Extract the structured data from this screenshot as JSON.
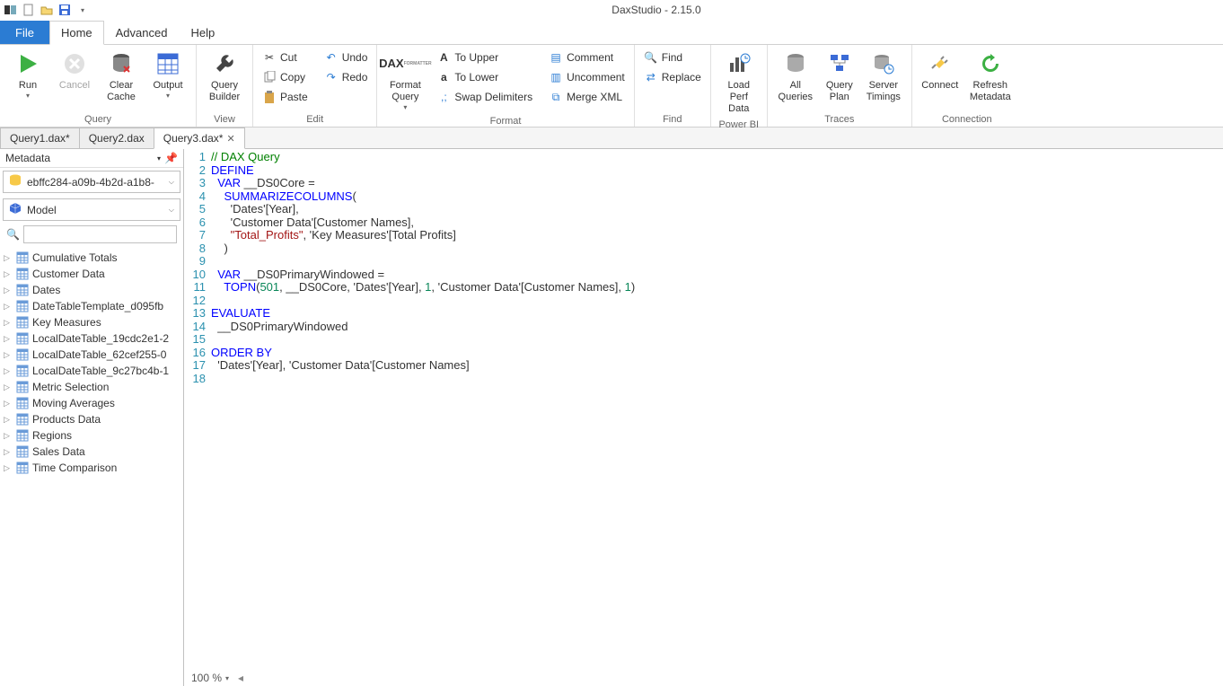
{
  "app_title": "DaxStudio - 2.15.0",
  "menu": {
    "file": "File",
    "tabs": [
      "Home",
      "Advanced",
      "Help"
    ],
    "active": "Home"
  },
  "ribbon": {
    "groups": {
      "query": {
        "label": "Query",
        "run": "Run",
        "cancel": "Cancel",
        "clear_cache": "Clear Cache",
        "output": "Output"
      },
      "view": {
        "label": "View",
        "query_builder": "Query Builder"
      },
      "edit": {
        "label": "Edit",
        "cut": "Cut",
        "copy": "Copy",
        "paste": "Paste",
        "undo": "Undo",
        "redo": "Redo"
      },
      "format": {
        "label": "Format",
        "format_query": "Format Query",
        "to_upper": "To Upper",
        "to_lower": "To Lower",
        "swap": "Swap Delimiters",
        "comment": "Comment",
        "uncomment": "Uncomment",
        "merge_xml": "Merge XML"
      },
      "find": {
        "label": "Find",
        "find": "Find",
        "replace": "Replace"
      },
      "powerbi": {
        "label": "Power BI",
        "load_perf": "Load Perf Data"
      },
      "traces": {
        "label": "Traces",
        "all_queries": "All Queries",
        "query_plan": "Query Plan",
        "server_timings": "Server Timings"
      },
      "connection": {
        "label": "Connection",
        "connect": "Connect",
        "refresh": "Refresh Metadata"
      }
    }
  },
  "doc_tabs": [
    {
      "label": "Query1.dax*",
      "active": false
    },
    {
      "label": "Query2.dax",
      "active": false
    },
    {
      "label": "Query3.dax*",
      "active": true
    }
  ],
  "metadata": {
    "title": "Metadata",
    "database": "ebffc284-a09b-4b2d-a1b8-",
    "model": "Model",
    "search": "",
    "tables": [
      "Cumulative Totals",
      "Customer Data",
      "Dates",
      "DateTableTemplate_d095fb",
      "Key Measures",
      "LocalDateTable_19cdc2e1-2",
      "LocalDateTable_62cef255-0",
      "LocalDateTable_9c27bc4b-1",
      "Metric Selection",
      "Moving Averages",
      "Products Data",
      "Regions",
      "Sales Data",
      "Time Comparison"
    ]
  },
  "editor": {
    "zoom": "100 %",
    "line_count": 18,
    "lines": [
      {
        "t": "comment",
        "text": "// DAX Query"
      },
      {
        "t": "kw",
        "text": "DEFINE"
      },
      {
        "indent": 1,
        "tokens": [
          {
            "t": "kw",
            "v": "VAR"
          },
          {
            "t": "plain",
            "v": " __DS0Core ="
          }
        ]
      },
      {
        "indent": 2,
        "tokens": [
          {
            "t": "func",
            "v": "SUMMARIZECOLUMNS"
          },
          {
            "t": "plain",
            "v": "("
          }
        ]
      },
      {
        "indent": 3,
        "tokens": [
          {
            "t": "plain",
            "v": "'Dates'[Year],"
          }
        ]
      },
      {
        "indent": 3,
        "tokens": [
          {
            "t": "plain",
            "v": "'Customer Data'[Customer Names],"
          }
        ]
      },
      {
        "indent": 3,
        "tokens": [
          {
            "t": "str",
            "v": "\"Total_Profits\""
          },
          {
            "t": "plain",
            "v": ", 'Key Measures'[Total Profits]"
          }
        ]
      },
      {
        "indent": 2,
        "tokens": [
          {
            "t": "plain",
            "v": ")"
          }
        ]
      },
      {
        "blank": true
      },
      {
        "indent": 1,
        "tokens": [
          {
            "t": "kw",
            "v": "VAR"
          },
          {
            "t": "plain",
            "v": " __DS0PrimaryWindowed ="
          }
        ]
      },
      {
        "indent": 2,
        "tokens": [
          {
            "t": "func",
            "v": "TOPN"
          },
          {
            "t": "plain",
            "v": "("
          },
          {
            "t": "num",
            "v": "501"
          },
          {
            "t": "plain",
            "v": ", __DS0Core, 'Dates'[Year], "
          },
          {
            "t": "num",
            "v": "1"
          },
          {
            "t": "plain",
            "v": ", 'Customer Data'[Customer Names], "
          },
          {
            "t": "num",
            "v": "1"
          },
          {
            "t": "plain",
            "v": ")"
          }
        ]
      },
      {
        "blank": true
      },
      {
        "tokens": [
          {
            "t": "kw",
            "v": "EVALUATE"
          }
        ]
      },
      {
        "indent": 1,
        "tokens": [
          {
            "t": "plain",
            "v": "__DS0PrimaryWindowed"
          }
        ]
      },
      {
        "blank": true
      },
      {
        "tokens": [
          {
            "t": "kw",
            "v": "ORDER BY"
          }
        ]
      },
      {
        "indent": 1,
        "tokens": [
          {
            "t": "plain",
            "v": "'Dates'[Year], 'Customer Data'[Customer Names]"
          }
        ]
      },
      {
        "blank": true
      }
    ]
  }
}
